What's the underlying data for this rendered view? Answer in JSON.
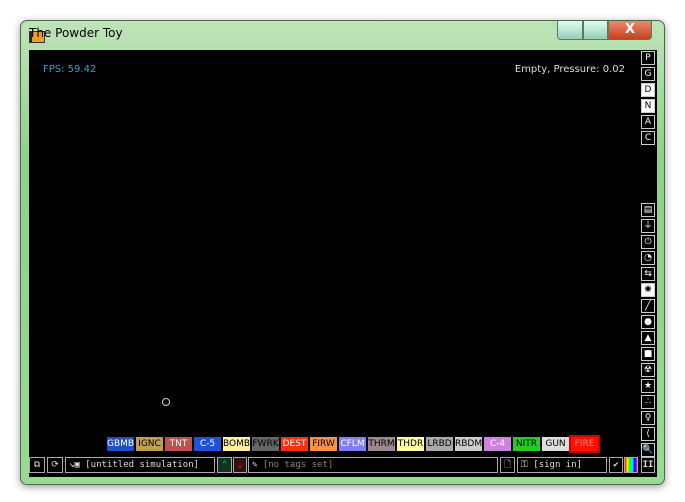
{
  "window": {
    "title": "The Powder Toy",
    "close": "X"
  },
  "hud": {
    "fps": "FPS: 59.42",
    "info": "Empty, Pressure: 0.02"
  },
  "render_modes": [
    {
      "label": "P",
      "selected": false
    },
    {
      "label": "G",
      "selected": false
    },
    {
      "label": "D",
      "selected": true
    },
    {
      "label": "N",
      "selected": true
    },
    {
      "label": "A",
      "selected": false
    },
    {
      "label": "C",
      "selected": false
    }
  ],
  "categories": [
    {
      "name": "walls",
      "glyph": "▤"
    },
    {
      "name": "electronics",
      "glyph": "⏚"
    },
    {
      "name": "powered",
      "glyph": "⏻"
    },
    {
      "name": "sensors",
      "glyph": "◔"
    },
    {
      "name": "force",
      "glyph": "⇆"
    },
    {
      "name": "explosives",
      "glyph": "✺",
      "selected": true
    },
    {
      "name": "gases",
      "glyph": "╱"
    },
    {
      "name": "liquids",
      "glyph": "●"
    },
    {
      "name": "powders",
      "glyph": "▲"
    },
    {
      "name": "solids",
      "glyph": "■"
    },
    {
      "name": "radioactive",
      "glyph": "☢"
    },
    {
      "name": "special",
      "glyph": "★"
    },
    {
      "name": "life",
      "glyph": "∴"
    },
    {
      "name": "tools",
      "glyph": "♀"
    },
    {
      "name": "favorites",
      "glyph": "⟨"
    },
    {
      "name": "search",
      "glyph": "🔍"
    }
  ],
  "elements": [
    {
      "label": "GBMB",
      "bg": "#1d4ecb",
      "fg": "#ffffff"
    },
    {
      "label": "IGNC",
      "bg": "#c0a050",
      "fg": "#000000"
    },
    {
      "label": "TNT",
      "bg": "#c05050",
      "fg": "#ffffff"
    },
    {
      "label": "C-5",
      "bg": "#2050e0",
      "fg": "#ffffff"
    },
    {
      "label": "BOMB",
      "bg": "#fff0a0",
      "fg": "#000000"
    },
    {
      "label": "FWRK",
      "bg": "#666666",
      "fg": "#000000"
    },
    {
      "label": "DEST",
      "bg": "#ff3010",
      "fg": "#ffffff"
    },
    {
      "label": "FIRW",
      "bg": "#ff9040",
      "fg": "#000000"
    },
    {
      "label": "CFLM",
      "bg": "#8080ff",
      "fg": "#ffffff"
    },
    {
      "label": "THRM",
      "bg": "#a08890",
      "fg": "#000000"
    },
    {
      "label": "THDR",
      "bg": "#ffffa0",
      "fg": "#000000"
    },
    {
      "label": "LRBD",
      "bg": "#aaaaaa",
      "fg": "#000000"
    },
    {
      "label": "RBDM",
      "bg": "#cccccc",
      "fg": "#000000"
    },
    {
      "label": "C-4",
      "bg": "#d080e0",
      "fg": "#ffffff"
    },
    {
      "label": "NITR",
      "bg": "#20d020",
      "fg": "#000000"
    },
    {
      "label": "GUN",
      "bg": "#dddddd",
      "fg": "#000000"
    },
    {
      "label": "FIRE",
      "bg": "#ff1000",
      "fg": "#ff8080",
      "selected": true
    }
  ],
  "bottom": {
    "save_name": "[untitled simulation]",
    "tags": "[no tags set]",
    "sign_in": "[sign in]",
    "pause": "II"
  }
}
